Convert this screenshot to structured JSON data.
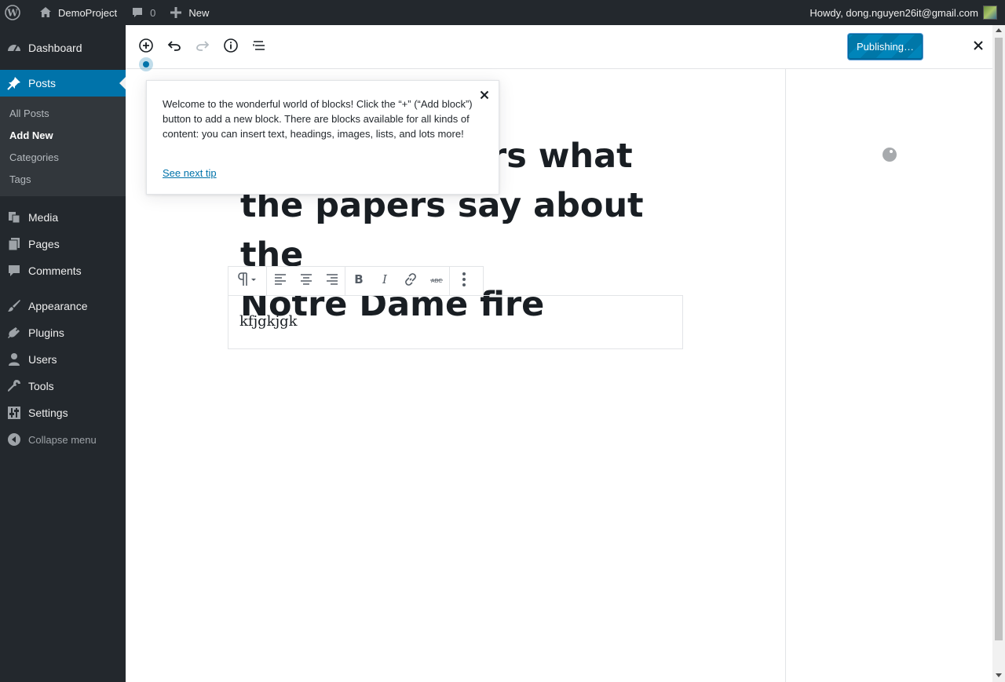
{
  "adminbar": {
    "site_name": "DemoProject",
    "comments_count": "0",
    "new_label": "New",
    "howdy": "Howdy, dong.nguyen26it@gmail.com"
  },
  "sidebar": {
    "items": [
      {
        "label": "Dashboard",
        "icon": "dashboard-icon"
      },
      {
        "label": "Posts",
        "icon": "pin-icon"
      },
      {
        "label": "Media",
        "icon": "media-icon"
      },
      {
        "label": "Pages",
        "icon": "pages-icon"
      },
      {
        "label": "Comments",
        "icon": "comments-icon"
      },
      {
        "label": "Appearance",
        "icon": "brush-icon"
      },
      {
        "label": "Plugins",
        "icon": "plug-icon"
      },
      {
        "label": "Users",
        "icon": "user-icon"
      },
      {
        "label": "Tools",
        "icon": "wrench-icon"
      },
      {
        "label": "Settings",
        "icon": "settings-icon"
      }
    ],
    "posts_submenu": [
      "All Posts",
      "Add New",
      "Categories",
      "Tags"
    ],
    "collapse_label": "Collapse menu"
  },
  "editor": {
    "publish_label": "Publishing…",
    "title_line1": "rs what",
    "title_line2": "the papers say about the",
    "title_line3": "Notre Dame fire",
    "paragraph": "kfjgkjgk"
  },
  "tip": {
    "text": "Welcome to the wonderful world of blocks! Click the “+” (“Add block”) button to add a new block. There are blocks available for all kinds of content: you can insert text, headings, images, lists, and lots more!",
    "next_label": "See next tip"
  },
  "colors": {
    "admin_dark": "#23282d",
    "accent_blue": "#0073aa",
    "publish_blue": "#0085ba"
  }
}
